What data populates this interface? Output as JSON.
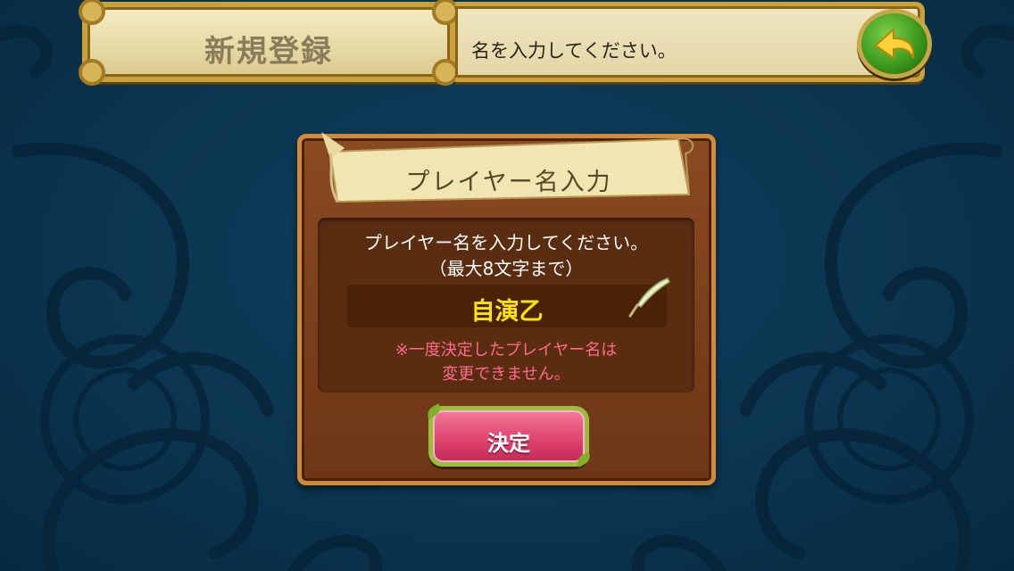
{
  "header": {
    "title": "新規登録",
    "message": "名を入力してください。"
  },
  "dialog": {
    "title": "プレイヤー名入力",
    "prompt_line1": "プレイヤー名を入力してください。",
    "prompt_line2": "（最大8文字まで）",
    "name_value": "自演乙",
    "warning_line1": "※一度決定したプレイヤー名は",
    "warning_line2": "変更できません。",
    "confirm_label": "決定"
  },
  "icons": {
    "back": "back-arrow-icon",
    "edit": "quill-icon"
  },
  "colors": {
    "background": "#0b3550",
    "name_text": "#ffe400",
    "warning_text": "#ff6a8e",
    "confirm_button": "#e04470",
    "back_button": "#3c9a1c"
  }
}
